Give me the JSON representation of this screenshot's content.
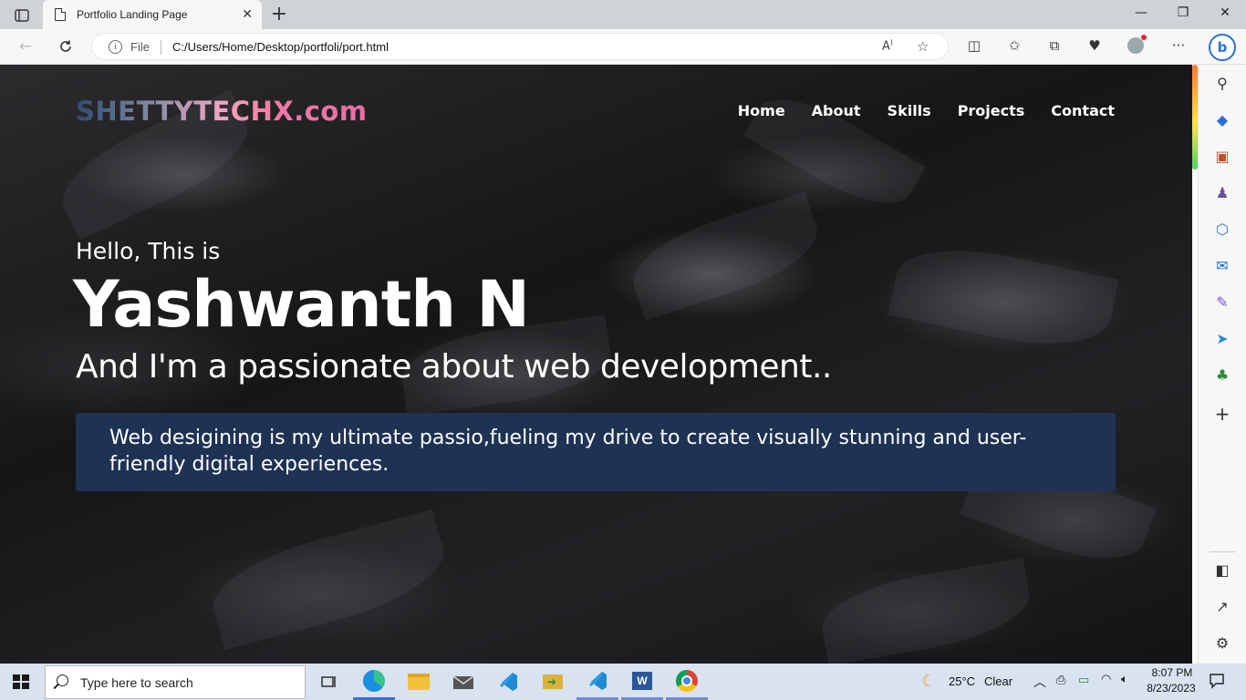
{
  "browser": {
    "tab_title": "Portfolio Landing Page",
    "address_prefix": "File",
    "url": "C:/Users/Home/Desktop/portfoli/port.html"
  },
  "site": {
    "logo": "SHETTYTECHX.com",
    "nav": [
      "Home",
      "About",
      "Skills",
      "Projects",
      "Contact"
    ],
    "hero": {
      "greeting": "Hello, This is",
      "name": "Yashwanth N",
      "tagline": "And I'm a passionate about web development..",
      "description": "Web desigining is my ultimate passio,fueling my drive to create visually stunning and user-friendly digital experiences."
    }
  },
  "taskbar": {
    "search_placeholder": "Type here to search",
    "weather_temp": "25°C",
    "weather_desc": "Clear",
    "time": "8:07 PM",
    "date": "8/23/2023"
  },
  "colors": {
    "info_box": "#1e3353",
    "logo_gradient": [
      "#2e4a72",
      "#f6a6c3",
      "#e86da6"
    ],
    "taskbar": "#d9e2ef"
  }
}
